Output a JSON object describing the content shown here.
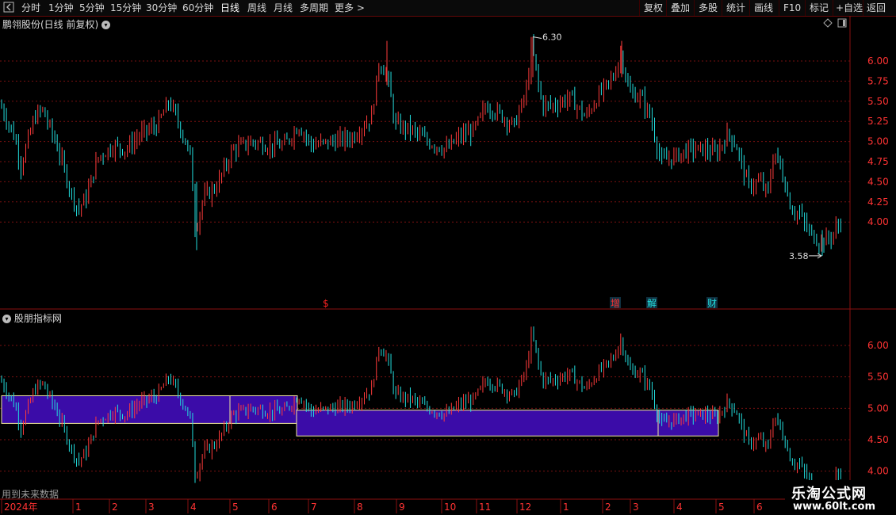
{
  "toolbar": {
    "periods": [
      "分时",
      "1分钟",
      "5分钟",
      "15分钟",
      "30分钟",
      "60分钟",
      "日线",
      "周线",
      "月线",
      "多周期",
      "更多 >"
    ],
    "active_period": "日线",
    "right_buttons": [
      "复权",
      "叠加",
      "多股",
      "统计",
      "画线",
      "F10",
      "标记",
      "+自选",
      "返回"
    ],
    "back_icon": "square-back-icon"
  },
  "main_chart": {
    "title": "鹏翎股份(日线 前复权)",
    "high_label": "6.30",
    "low_label": "3.58",
    "yticks": [
      "6.00",
      "5.75",
      "5.50",
      "5.25",
      "5.00",
      "4.75",
      "4.50",
      "4.25",
      "4.00"
    ],
    "event_markers": [
      {
        "text": "$",
        "color": "#ff2222"
      },
      {
        "text": "增",
        "color": "#ff3333"
      },
      {
        "text": "解",
        "color": "#22dddd"
      },
      {
        "text": "财",
        "color": "#22dddd"
      }
    ]
  },
  "indicator_panel": {
    "title": "股朋指标网",
    "yticks": [
      "6.00",
      "5.50",
      "5.00",
      "4.50",
      "4.00"
    ],
    "zone_color": "#3b0ca8",
    "zone_border": "#f2e8a0",
    "footer_note": "用到未来数据"
  },
  "xaxis": {
    "labels": [
      "2024年",
      "1",
      "2",
      "3",
      "4",
      "5",
      "6",
      "7",
      "8",
      "9",
      "10",
      "11",
      "12",
      "1",
      "2",
      "3",
      "4",
      "5",
      "6"
    ]
  },
  "colors": {
    "up": "#ff3b3b",
    "down": "#22dddd",
    "grid": "#7a1010",
    "axis": "#8a1010",
    "label": "#ff3333"
  },
  "watermark": {
    "title": "乐淘公式网",
    "url": "www.60lt.com"
  }
}
